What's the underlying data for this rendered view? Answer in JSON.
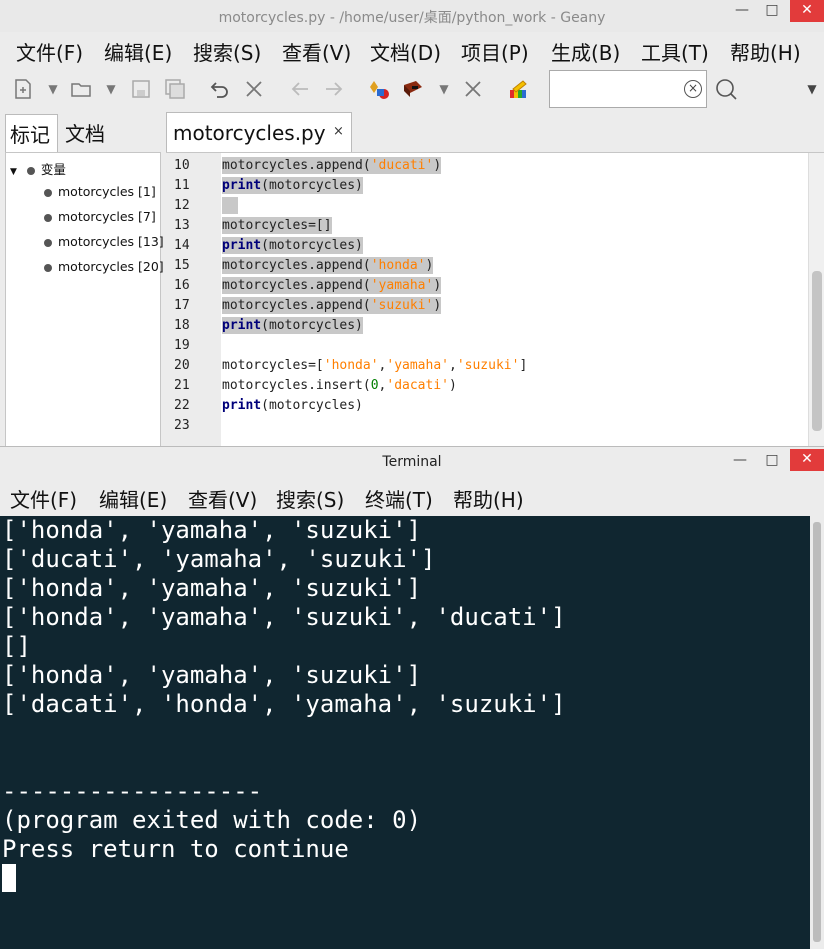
{
  "geany": {
    "title": "motorcycles.py - /home/user/桌面/python_work - Geany",
    "menu": [
      "文件(F)",
      "编辑(E)",
      "搜索(S)",
      "查看(V)",
      "文档(D)",
      "项目(P)",
      "生成(B)",
      "工具(T)",
      "帮助(H)"
    ],
    "search": {
      "value": ""
    },
    "sidebar": {
      "tabs": [
        "标记",
        "文档"
      ],
      "root": "变量",
      "items": [
        "motorcycles [1]",
        "motorcycles [7]",
        "motorcycles [13]",
        "motorcycles [20]"
      ]
    },
    "editor": {
      "tab_label": "motorcycles.py",
      "tab_close": "×",
      "line_numbers": [
        "10",
        "11",
        "12",
        "13",
        "14",
        "15",
        "16",
        "17",
        "18",
        "19",
        "20",
        "21",
        "22",
        "23"
      ]
    }
  },
  "terminal": {
    "title": "Terminal",
    "menu": [
      "文件(F)",
      "编辑(E)",
      "查看(V)",
      "搜索(S)",
      "终端(T)",
      "帮助(H)"
    ],
    "output": [
      "['honda', 'yamaha', 'suzuki']",
      "['ducati', 'yamaha', 'suzuki']",
      "['honda', 'yamaha', 'suzuki']",
      "['honda', 'yamaha', 'suzuki', 'ducati']",
      "[]",
      "['honda', 'yamaha', 'suzuki']",
      "['dacati', 'honda', 'yamaha', 'suzuki']",
      "",
      "",
      "------------------",
      "(program exited with code: 0)",
      "Press return to continue"
    ]
  },
  "colors": {
    "terminal_bg": "#102630",
    "close_button": "#e23b3b",
    "keyword": "#00007a",
    "string": "#ff7f00",
    "selection": "#c8c8c8"
  }
}
